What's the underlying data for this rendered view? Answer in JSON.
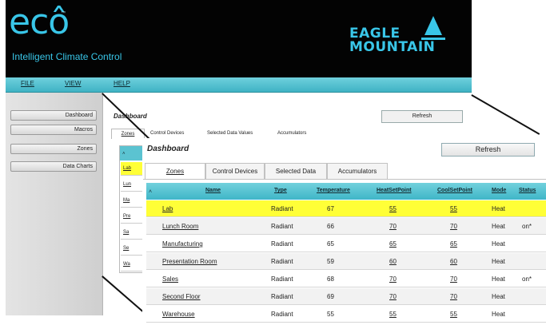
{
  "app": {
    "logo": "ecô",
    "logo_tm": "™",
    "tagline": "Intelligent Climate Control",
    "brand": [
      "EAGLE",
      "MOUNTAIN"
    ]
  },
  "menu": [
    "FILE",
    "VIEW",
    "HELP"
  ],
  "sidebar": [
    "Dashboard",
    "Macros",
    "Zones",
    "Data Charts"
  ],
  "background_view": {
    "title": "Dashboard",
    "refresh": "Refresh",
    "tabs": [
      "Zones",
      "Control Devices",
      "Selected Data Values",
      "Accumulators"
    ],
    "header_sort": "˄",
    "rows": [
      "Lab",
      "Lun",
      "Ma",
      "Pre",
      "Sa",
      "Se",
      "Wa"
    ]
  },
  "dashboard": {
    "title": "Dashboard",
    "refresh": "Refresh",
    "tabs": [
      "Zones",
      "Control Devices",
      "Selected Data Values",
      "Accumulators"
    ],
    "active_tab": "Zones",
    "header_sort": "˄",
    "columns": [
      "Name",
      "Type",
      "Temperature",
      "HeatSetPoint",
      "CoolSetPoint",
      "Mode",
      "Status"
    ],
    "rows": [
      {
        "name": "Lab",
        "type": "Radiant",
        "temp": "67",
        "heat": "55",
        "cool": "55",
        "mode": "Heat",
        "status": "",
        "selected": true
      },
      {
        "name": "Lunch Room",
        "type": "Radiant",
        "temp": "66",
        "heat": "70",
        "cool": "70",
        "mode": "Heat",
        "status": "on*"
      },
      {
        "name": "Manufacturing",
        "type": "Radiant",
        "temp": "65",
        "heat": "65",
        "cool": "65",
        "mode": "Heat",
        "status": ""
      },
      {
        "name": "Presentation Room",
        "type": "Radiant",
        "temp": "59",
        "heat": "60",
        "cool": "60",
        "mode": "Heat",
        "status": ""
      },
      {
        "name": "Sales",
        "type": "Radiant",
        "temp": "68",
        "heat": "70",
        "cool": "70",
        "mode": "Heat",
        "status": "on*"
      },
      {
        "name": "Second Floor",
        "type": "Radiant",
        "temp": "69",
        "heat": "70",
        "cool": "70",
        "mode": "Heat",
        "status": ""
      },
      {
        "name": "Warehouse",
        "type": "Radiant",
        "temp": "55",
        "heat": "55",
        "cool": "55",
        "mode": "Heat",
        "status": ""
      }
    ]
  },
  "colors": {
    "accent": "#39c6e8",
    "header_bg": "#030303",
    "menu_bar": "#4fbfcd",
    "selected_row": "#ffff37"
  }
}
